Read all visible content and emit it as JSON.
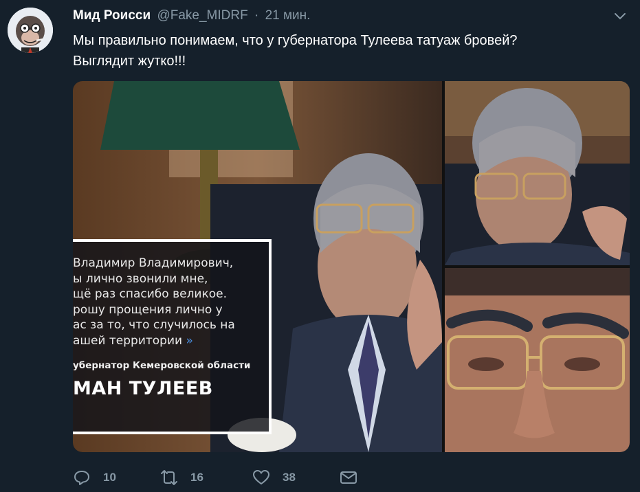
{
  "tweet": {
    "name": "Мид Роисси",
    "handle": "@Fake_MIDRF",
    "separator": "·",
    "time": "21 мин.",
    "text_lines": [
      "Мы правильно понимаем, что у губернатора Тулеева татуаж бровей?",
      "Выглядит жутко!!!"
    ]
  },
  "media": {
    "quote": {
      "lines": "Владимир Владимирович,\nы лично звонили мне,\nщё раз спасибо великое.\nрошу прощения лично у\nас за то, что случилось на\nашей территории",
      "close_mark": "»",
      "position": "убернатор Кемеровской области",
      "name": "МАН ТУЛЕЕВ"
    }
  },
  "actions": {
    "reply_count": "10",
    "retweet_count": "16",
    "like_count": "38"
  },
  "icons": {
    "reply": "reply-icon",
    "retweet": "retweet-icon",
    "like": "heart-icon",
    "dm": "envelope-icon",
    "menu": "chevron-down-icon"
  },
  "colors": {
    "background": "#15202b",
    "secondary_text": "#8899a6",
    "quote_accent": "#4a90e2"
  }
}
